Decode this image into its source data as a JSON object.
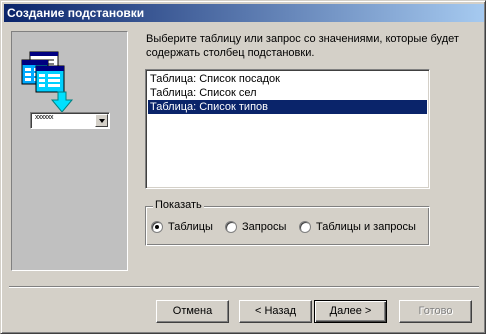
{
  "window": {
    "title": "Создание подстановки"
  },
  "illustration": {
    "dropdown_text": "xxxxxx"
  },
  "instructions": "Выберите таблицу или запрос со значениями, которые будет содержать столбец подстановки.",
  "list": {
    "items": [
      {
        "label": "Таблица: Список посадок",
        "selected": false
      },
      {
        "label": "Таблица: Список сел",
        "selected": false
      },
      {
        "label": "Таблица: Список типов",
        "selected": true
      }
    ]
  },
  "show_group": {
    "legend": "Показать",
    "options": [
      {
        "label": "Таблицы",
        "checked": true
      },
      {
        "label": "Запросы",
        "checked": false
      },
      {
        "label": "Таблицы и запросы",
        "checked": false
      }
    ]
  },
  "buttons": {
    "cancel": "Отмена",
    "back": "< Назад",
    "next": "Далее >",
    "finish": "Готово"
  },
  "colors": {
    "selection": "#0a246a",
    "titlebar_start": "#0a246a",
    "titlebar_end": "#a6caf0"
  }
}
